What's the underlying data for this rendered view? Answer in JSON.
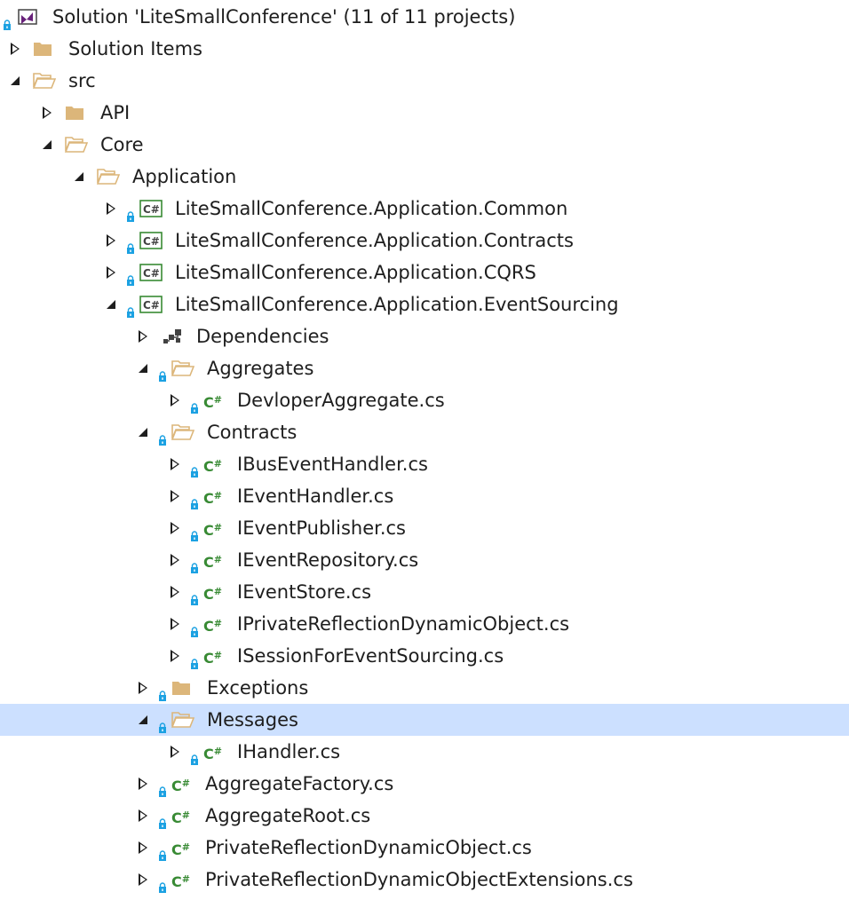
{
  "tree": {
    "items": [
      {
        "label": "Solution 'LiteSmallConference' (11 of 11 projects)",
        "depth": 0,
        "expander": "none",
        "lock": true,
        "icon": "solution-icon"
      },
      {
        "label": "Solution Items",
        "depth": 0,
        "expander": "collapsed",
        "lock": false,
        "icon": "folder-closed-icon"
      },
      {
        "label": "src",
        "depth": 0,
        "expander": "expanded",
        "lock": false,
        "icon": "folder-open-icon"
      },
      {
        "label": "API",
        "depth": 1,
        "expander": "collapsed",
        "lock": false,
        "icon": "folder-closed-icon"
      },
      {
        "label": "Core",
        "depth": 1,
        "expander": "expanded",
        "lock": false,
        "icon": "folder-open-icon"
      },
      {
        "label": "Application",
        "depth": 2,
        "expander": "expanded",
        "lock": false,
        "icon": "folder-open-icon"
      },
      {
        "label": "LiteSmallConference.Application.Common",
        "depth": 3,
        "expander": "collapsed",
        "lock": true,
        "icon": "csharp-project-icon"
      },
      {
        "label": "LiteSmallConference.Application.Contracts",
        "depth": 3,
        "expander": "collapsed",
        "lock": true,
        "icon": "csharp-project-icon"
      },
      {
        "label": "LiteSmallConference.Application.CQRS",
        "depth": 3,
        "expander": "collapsed",
        "lock": true,
        "icon": "csharp-project-icon"
      },
      {
        "label": "LiteSmallConference.Application.EventSourcing",
        "depth": 3,
        "expander": "expanded",
        "lock": true,
        "icon": "csharp-project-icon"
      },
      {
        "label": "Dependencies",
        "depth": 4,
        "expander": "collapsed",
        "lock": false,
        "icon": "dependencies-icon"
      },
      {
        "label": "Aggregates",
        "depth": 4,
        "expander": "expanded",
        "lock": true,
        "icon": "folder-open-icon"
      },
      {
        "label": "DevloperAggregate.cs",
        "depth": 5,
        "expander": "collapsed",
        "lock": true,
        "icon": "csharp-file-icon"
      },
      {
        "label": "Contracts",
        "depth": 4,
        "expander": "expanded",
        "lock": true,
        "icon": "folder-open-icon"
      },
      {
        "label": "IBusEventHandler.cs",
        "depth": 5,
        "expander": "collapsed",
        "lock": true,
        "icon": "csharp-file-icon"
      },
      {
        "label": "IEventHandler.cs",
        "depth": 5,
        "expander": "collapsed",
        "lock": true,
        "icon": "csharp-file-icon"
      },
      {
        "label": "IEventPublisher.cs",
        "depth": 5,
        "expander": "collapsed",
        "lock": true,
        "icon": "csharp-file-icon"
      },
      {
        "label": "IEventRepository.cs",
        "depth": 5,
        "expander": "collapsed",
        "lock": true,
        "icon": "csharp-file-icon"
      },
      {
        "label": "IEventStore.cs",
        "depth": 5,
        "expander": "collapsed",
        "lock": true,
        "icon": "csharp-file-icon"
      },
      {
        "label": "IPrivateReflectionDynamicObject.cs",
        "depth": 5,
        "expander": "collapsed",
        "lock": true,
        "icon": "csharp-file-icon"
      },
      {
        "label": "ISessionForEventSourcing.cs",
        "depth": 5,
        "expander": "collapsed",
        "lock": true,
        "icon": "csharp-file-icon"
      },
      {
        "label": "Exceptions",
        "depth": 4,
        "expander": "collapsed",
        "lock": true,
        "icon": "folder-closed-icon"
      },
      {
        "label": "Messages",
        "depth": 4,
        "expander": "expanded",
        "lock": true,
        "icon": "folder-open-icon",
        "selected": true
      },
      {
        "label": "IHandler.cs",
        "depth": 5,
        "expander": "collapsed",
        "lock": true,
        "icon": "csharp-file-icon"
      },
      {
        "label": "AggregateFactory.cs",
        "depth": 4,
        "expander": "collapsed",
        "lock": true,
        "icon": "csharp-file-icon"
      },
      {
        "label": "AggregateRoot.cs",
        "depth": 4,
        "expander": "collapsed",
        "lock": true,
        "icon": "csharp-file-icon"
      },
      {
        "label": "PrivateReflectionDynamicObject.cs",
        "depth": 4,
        "expander": "collapsed",
        "lock": true,
        "icon": "csharp-file-icon"
      },
      {
        "label": "PrivateReflectionDynamicObjectExtensions.cs",
        "depth": 4,
        "expander": "collapsed",
        "lock": true,
        "icon": "csharp-file-icon"
      }
    ]
  },
  "colors": {
    "selection": "#cce0ff",
    "folder": "#dcb67a",
    "lock": "#1ba1e2",
    "csharp": "#388a34",
    "solution": "#68217a"
  }
}
